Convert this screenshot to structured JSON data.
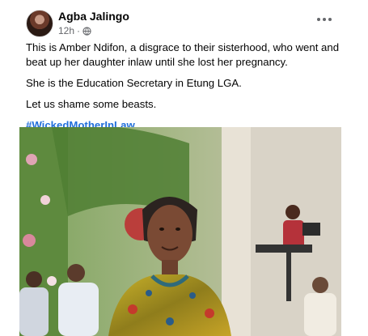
{
  "post": {
    "author": "Agba Jalingo",
    "time": "12h",
    "separator": "·",
    "privacy_icon": "globe-icon",
    "more_icon": "more-horizontal-icon",
    "paragraphs": [
      "This is Amber Ndifon, a disgrace to their sisterhood, who went and beat up her daughter inlaw until she lost her pregnancy.",
      "She is the Education Secretary in Etung LGA.",
      "Let us shame some beasts."
    ],
    "hashtag": "#WickedMotherInLaw"
  },
  "colors": {
    "link": "#216fdb",
    "meta": "#65676b",
    "text": "#050505"
  }
}
